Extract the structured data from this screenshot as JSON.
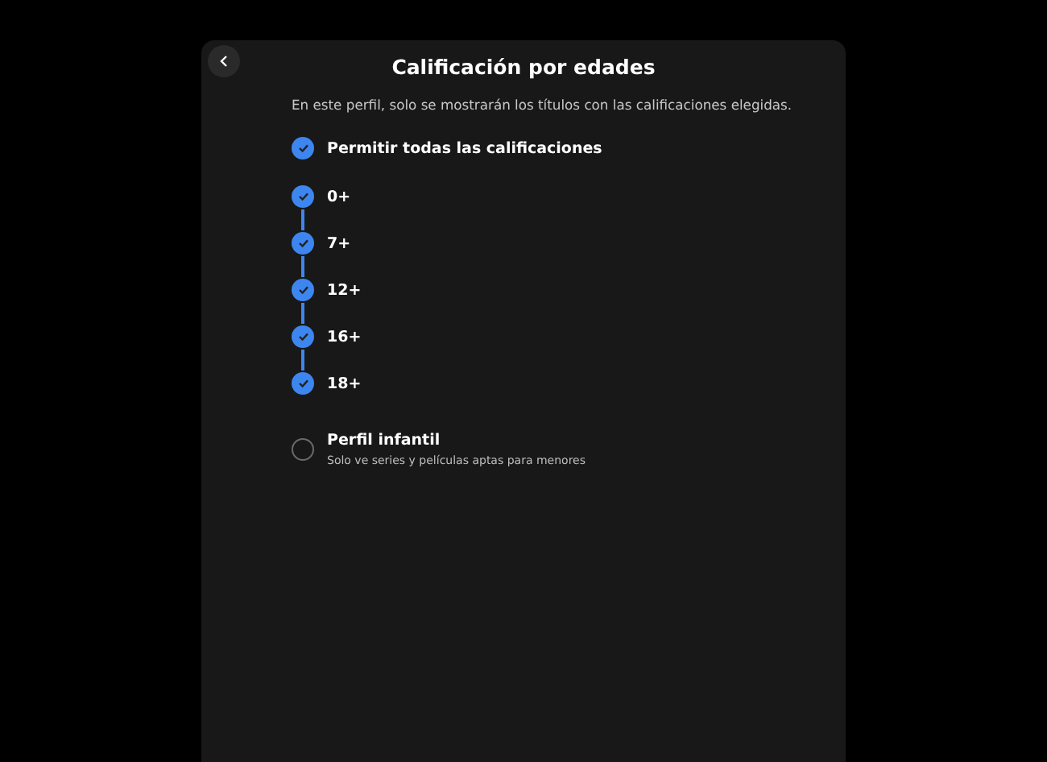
{
  "dialog": {
    "title": "Calificación por edades",
    "description": "En este perfil, solo se mostrarán los títulos con las calificaciones elegidas."
  },
  "allow_all": {
    "label": "Permitir todas las calificaciones",
    "checked": true
  },
  "ratings": [
    {
      "label": "0+",
      "checked": true
    },
    {
      "label": "7+",
      "checked": true
    },
    {
      "label": "12+",
      "checked": true
    },
    {
      "label": "16+",
      "checked": true
    },
    {
      "label": "18+",
      "checked": true
    }
  ],
  "kids_profile": {
    "label": "Perfil infantil",
    "subtitle": "Solo ve series y películas aptas para menores",
    "checked": false
  }
}
